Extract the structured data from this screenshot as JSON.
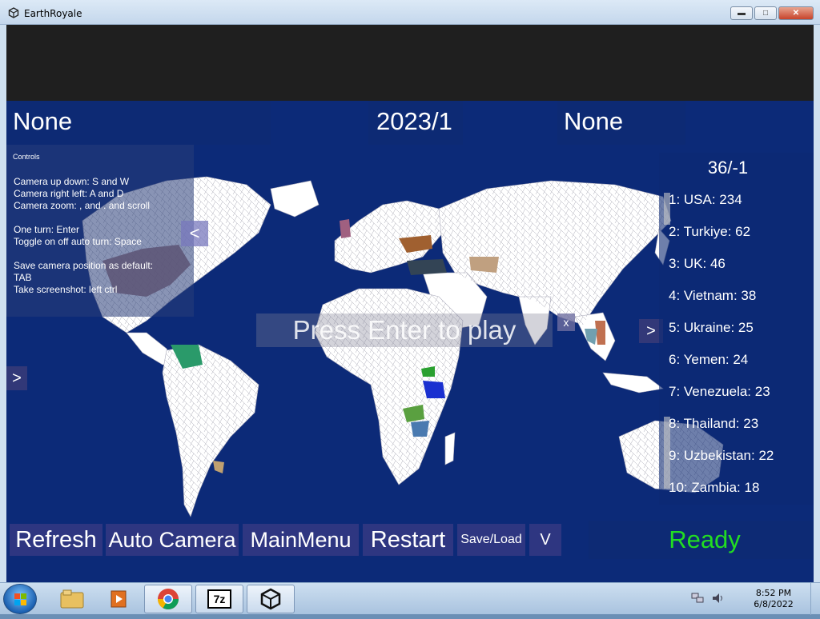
{
  "window": {
    "title": "EarthRoyale"
  },
  "hud": {
    "left_country": "None",
    "date": "2023/1",
    "right_country": "None"
  },
  "controls": {
    "title": "Controls",
    "lines": "Camera up down: S and W\nCamera right left: A and D\nCamera zoom: , and . and scroll\n\nOne turn: Enter\nToggle on off auto turn: Space\n\nSave camera position as default:\nTAB\nTake screenshot: left ctrl",
    "collapse_label": "<"
  },
  "left_expand_label": ">",
  "press_enter": {
    "text": "Press Enter to play",
    "close_label": "x"
  },
  "ranking": {
    "header": "36/-1",
    "expand_label": ">",
    "items": [
      "1: USA: 234",
      "2: Turkiye: 62",
      "3: UK: 46",
      "4: Vietnam: 38",
      "5: Ukraine: 25",
      "6: Yemen: 24",
      "7: Venezuela: 23",
      "8: Thailand: 23",
      "9: Uzbekistan: 22",
      "10: Zambia: 18"
    ]
  },
  "toolbar": {
    "refresh": "Refresh",
    "auto_camera": "Auto Camera",
    "main_menu": "MainMenu",
    "restart": "Restart",
    "save_load": "Save/Load",
    "more": "V"
  },
  "status": {
    "text": "Ready",
    "color": "#22dd22"
  },
  "colors": {
    "ocean": "#0c2a78",
    "land": "#ffffff",
    "hud_panel": "#0e2a73"
  },
  "taskbar": {
    "icons": [
      "windows-start-icon",
      "file-explorer-icon",
      "media-player-icon",
      "chrome-icon",
      "7zip-icon",
      "unity-icon"
    ],
    "label_7z": "7z",
    "time": "8:52 PM",
    "date": "6/8/2022"
  }
}
